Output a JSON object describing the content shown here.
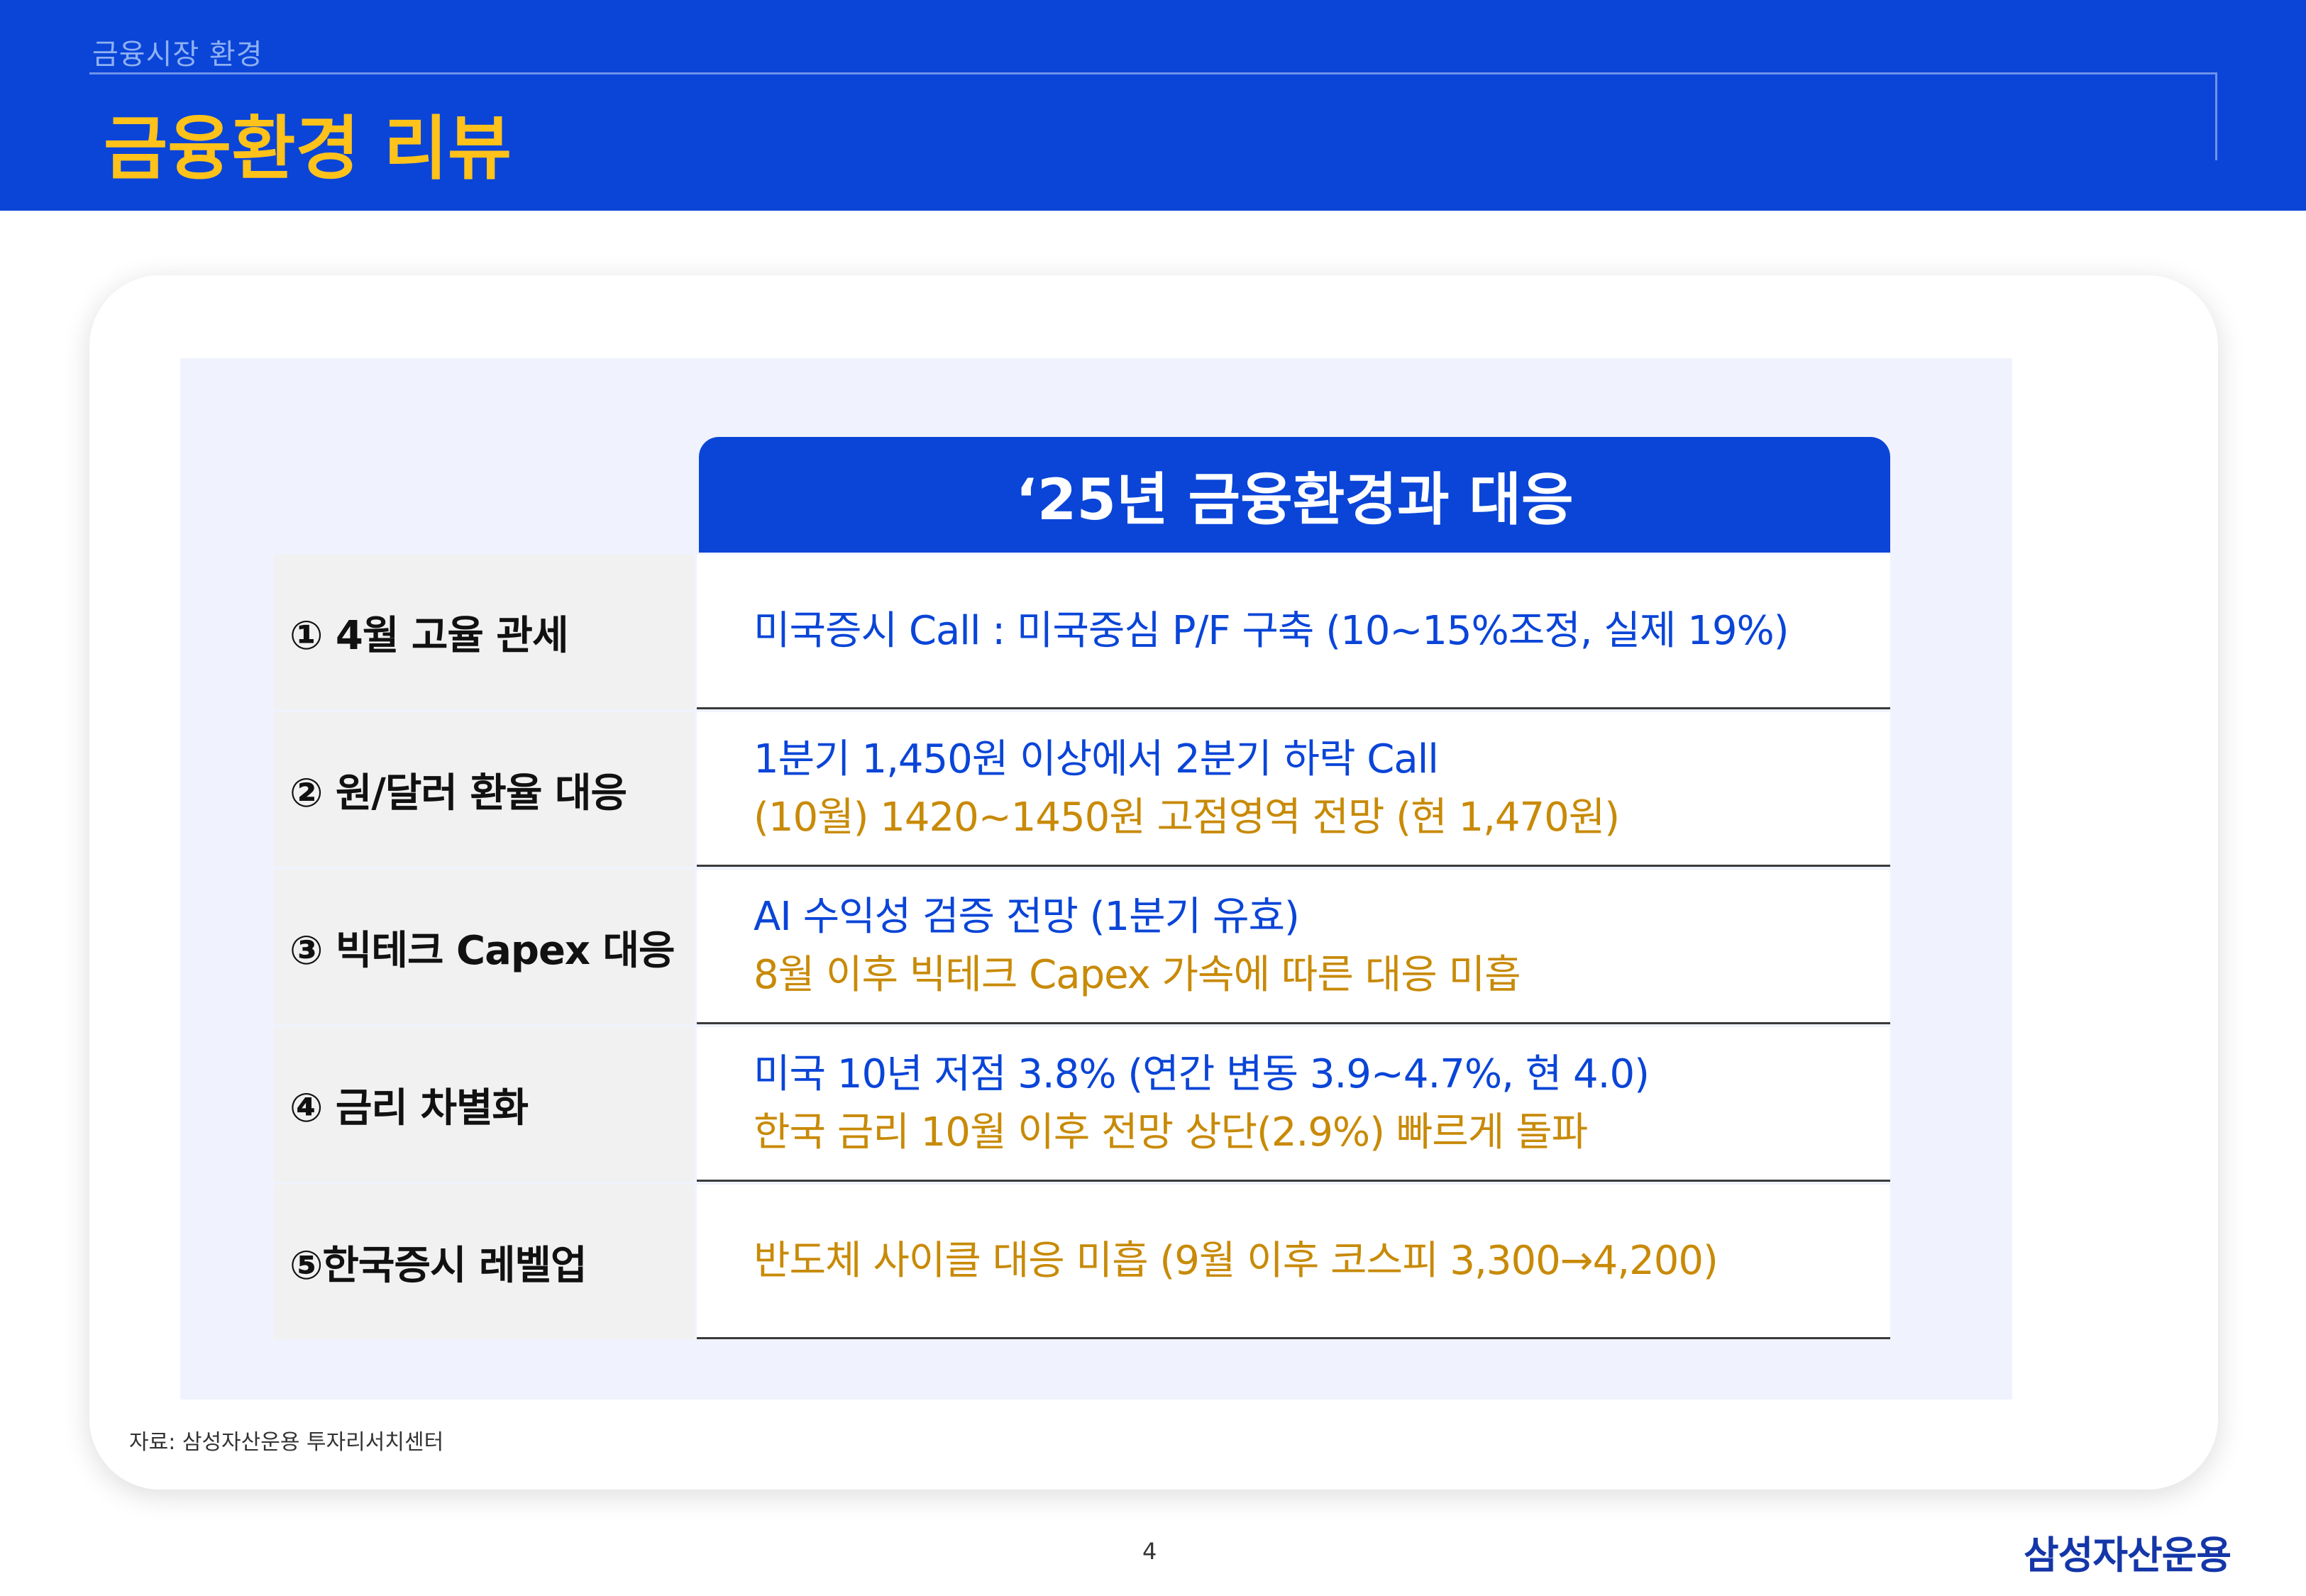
{
  "header": {
    "section": "금융시장 환경",
    "title": "금융환경 리뷰"
  },
  "table": {
    "heading": "‘25년 금융환경과 대응",
    "rows": [
      {
        "label": "① 4월 고율 관세",
        "lines": [
          {
            "text": "미국증시 Call : 미국중심 P/F 구축 (10~15%조정, 실제 19%)",
            "color": "blue"
          }
        ]
      },
      {
        "label": "② 원/달러 환율 대응",
        "lines": [
          {
            "text": "1분기 1,450원 이상에서 2분기 하락 Call",
            "color": "blue"
          },
          {
            "text": "(10월) 1420~1450원 고점영역 전망  (현 1,470원)",
            "color": "gold"
          }
        ]
      },
      {
        "label": "③ 빅테크 Capex 대응",
        "lines": [
          {
            "text": "AI 수익성 검증 전망 (1분기 유효)",
            "color": "blue"
          },
          {
            "text": "8월 이후 빅테크 Capex 가속에 따른 대응 미흡",
            "color": "gold"
          }
        ]
      },
      {
        "label": "④ 금리 차별화",
        "lines": [
          {
            "text": "미국 10년 저점 3.8% (연간 변동 3.9~4.7%, 현 4.0)",
            "color": "blue"
          },
          {
            "text": "한국 금리 10월 이후 전망 상단(2.9%) 빠르게 돌파",
            "color": "gold"
          }
        ]
      },
      {
        "label": "⑤한국증시 레벨업",
        "lines": [
          {
            "text": "반도체 사이클 대응 미흡 (9월 이후 코스피 3,300→4,200)",
            "color": "gold"
          }
        ]
      }
    ]
  },
  "colors": {
    "blue": "#0a45d8",
    "gold": "#c88a07",
    "title_yellow": "#ffc21a"
  },
  "footer": {
    "source": "자료: 삼성자산운용 투자리서치센터",
    "page": "4",
    "brand": "삼성자산운용"
  }
}
